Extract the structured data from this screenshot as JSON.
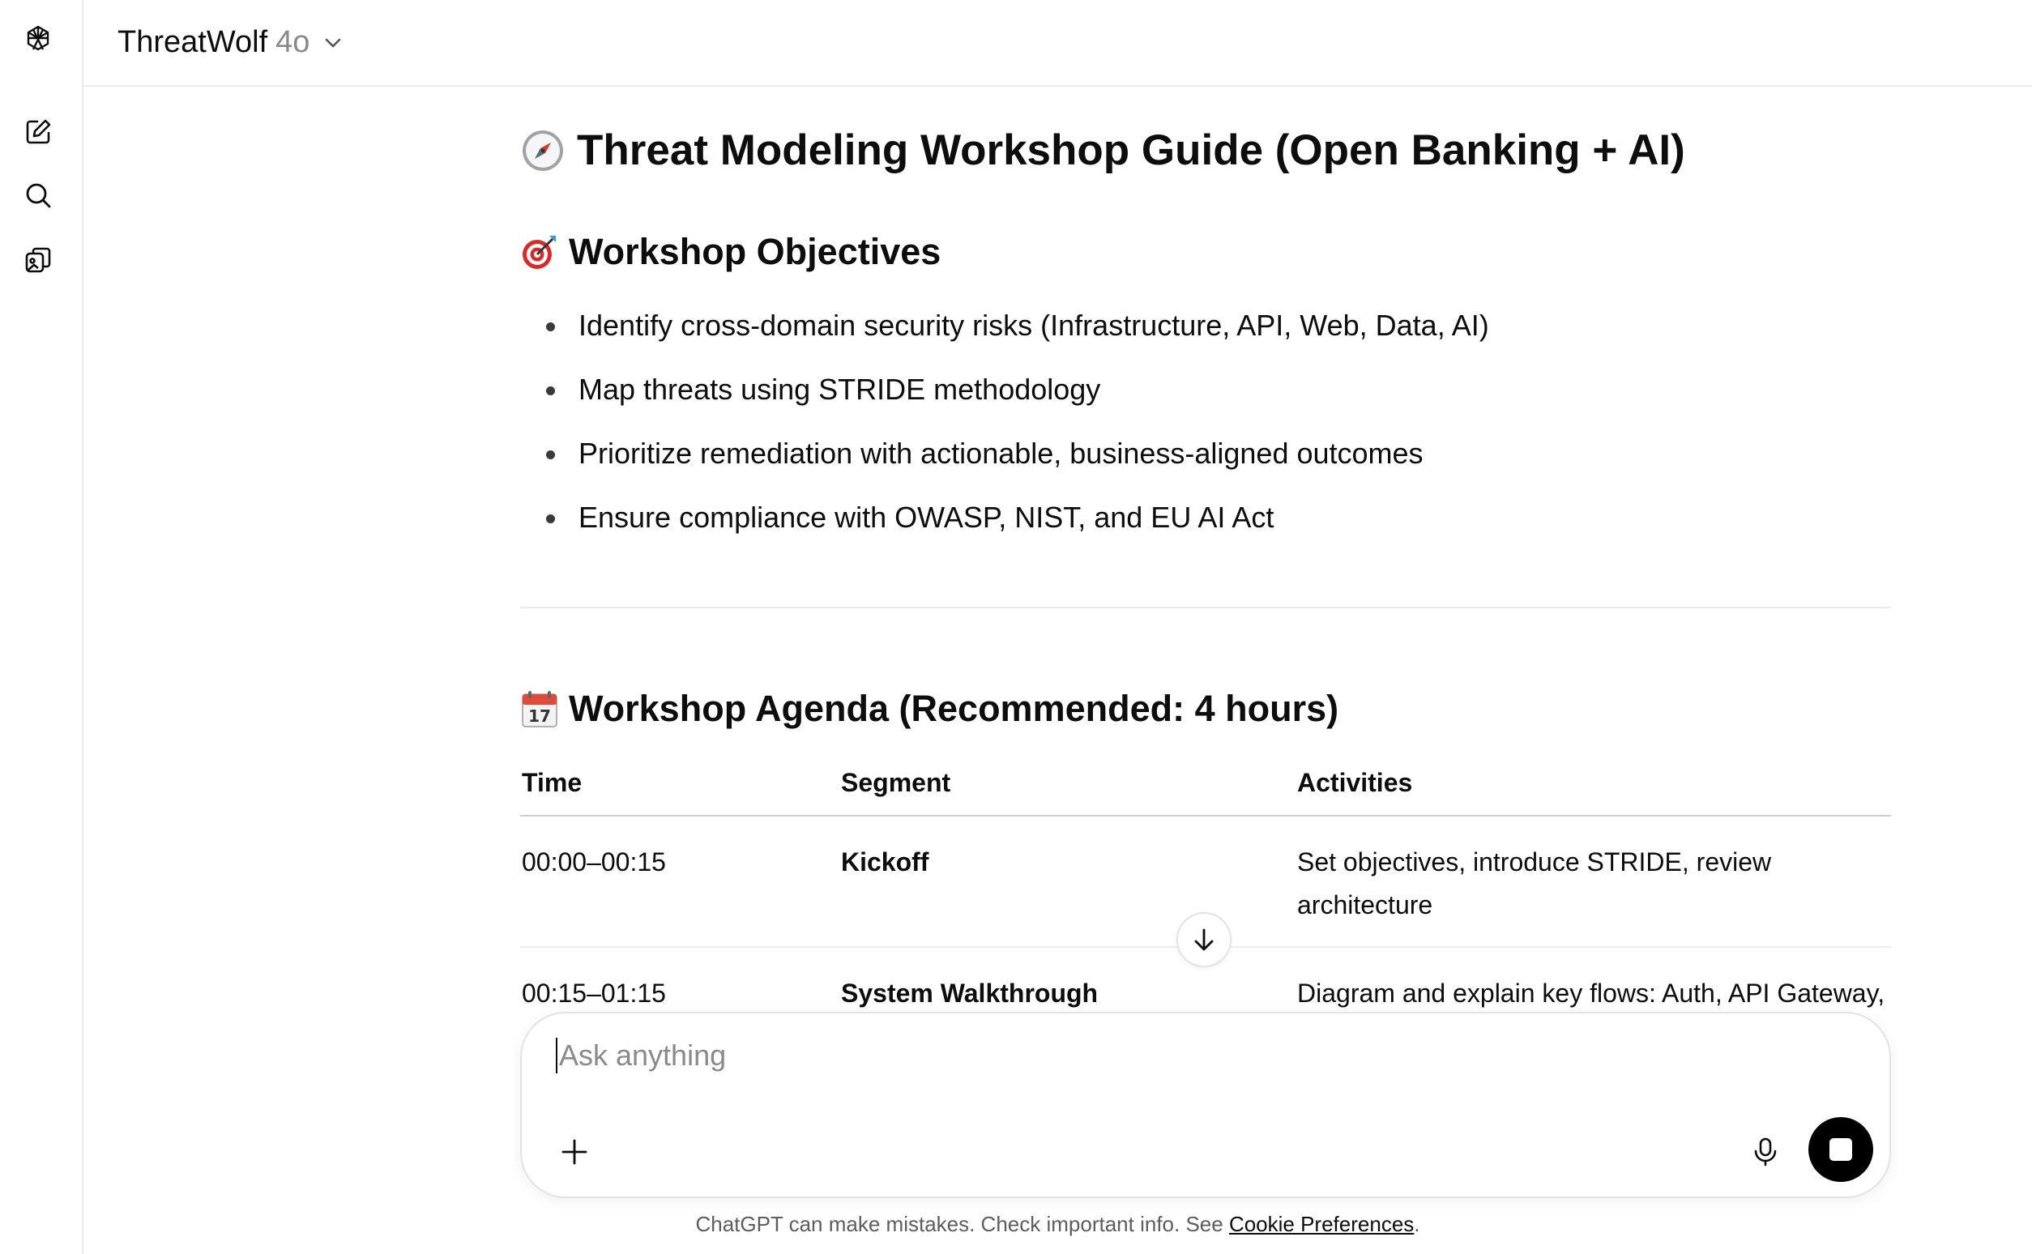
{
  "header": {
    "model_name": "ThreatWolf",
    "model_version": "4o"
  },
  "sidebar": {
    "icons": [
      "openai-logo-icon",
      "new-chat-icon",
      "search-icon",
      "library-icon"
    ]
  },
  "document": {
    "title": "Threat Modeling Workshop Guide (Open Banking + AI)",
    "title_emoji": "compass-emoji",
    "objectives": {
      "heading": "Workshop Objectives",
      "emoji": "target-emoji",
      "items": [
        "Identify cross-domain security risks (Infrastructure, API, Web, Data, AI)",
        "Map threats using STRIDE methodology",
        "Prioritize remediation with actionable, business-aligned outcomes",
        "Ensure compliance with OWASP, NIST, and EU AI Act"
      ]
    },
    "agenda": {
      "heading": "Workshop Agenda (Recommended: 4 hours)",
      "emoji": "calendar-emoji",
      "calendar_day": "17",
      "columns": [
        "Time",
        "Segment",
        "Activities"
      ],
      "rows": [
        {
          "time": "00:00–00:15",
          "segment": "Kickoff",
          "activities": "Set objectives, introduce STRIDE, review architecture"
        },
        {
          "time": "00:15–01:15",
          "segment": "System Walkthrough",
          "activities": "Diagram and explain key flows: Auth, API Gateway, Consent Handling, AI integrations"
        }
      ]
    }
  },
  "composer": {
    "placeholder": "Ask anything"
  },
  "footer": {
    "disclaimer_prefix": "ChatGPT can make mistakes. Check important info. See ",
    "link_text": "Cookie Preferences",
    "disclaimer_suffix": "."
  }
}
